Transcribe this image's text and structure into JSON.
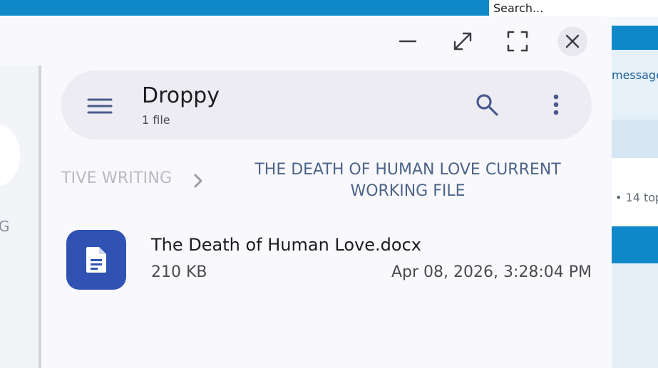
{
  "background": {
    "search_text": "Search...",
    "message_snippet": "message",
    "topics_snippet": "• 14 top",
    "left_letter": "G",
    "colors": {
      "browser_blue": "#0f88c9"
    }
  },
  "window": {
    "controls": {
      "minimize": "minimize-icon",
      "expand": "expand-diagonal-icon",
      "fullscreen": "fullscreen-icon",
      "close": "close-icon"
    }
  },
  "topbar": {
    "title": "Droppy",
    "subtitle": "1 file",
    "icons": {
      "menu": "hamburger-menu-icon",
      "search": "search-icon",
      "more": "more-vert-icon"
    }
  },
  "breadcrumb": {
    "previous": "TIVE WRITING",
    "current": "THE DEATH OF HUMAN LOVE CURRENT WORKING FILE"
  },
  "files": [
    {
      "name": "The Death of Human Love.docx",
      "size": "210 KB",
      "modified": "Apr 08, 2026, 3:28:04 PM",
      "icon": "document-icon",
      "icon_color": "#2f52b3"
    }
  ],
  "colors": {
    "accent": "#2f52b3",
    "icon_blue": "#4a5a8c",
    "crumb_blue": "#4d6489"
  }
}
